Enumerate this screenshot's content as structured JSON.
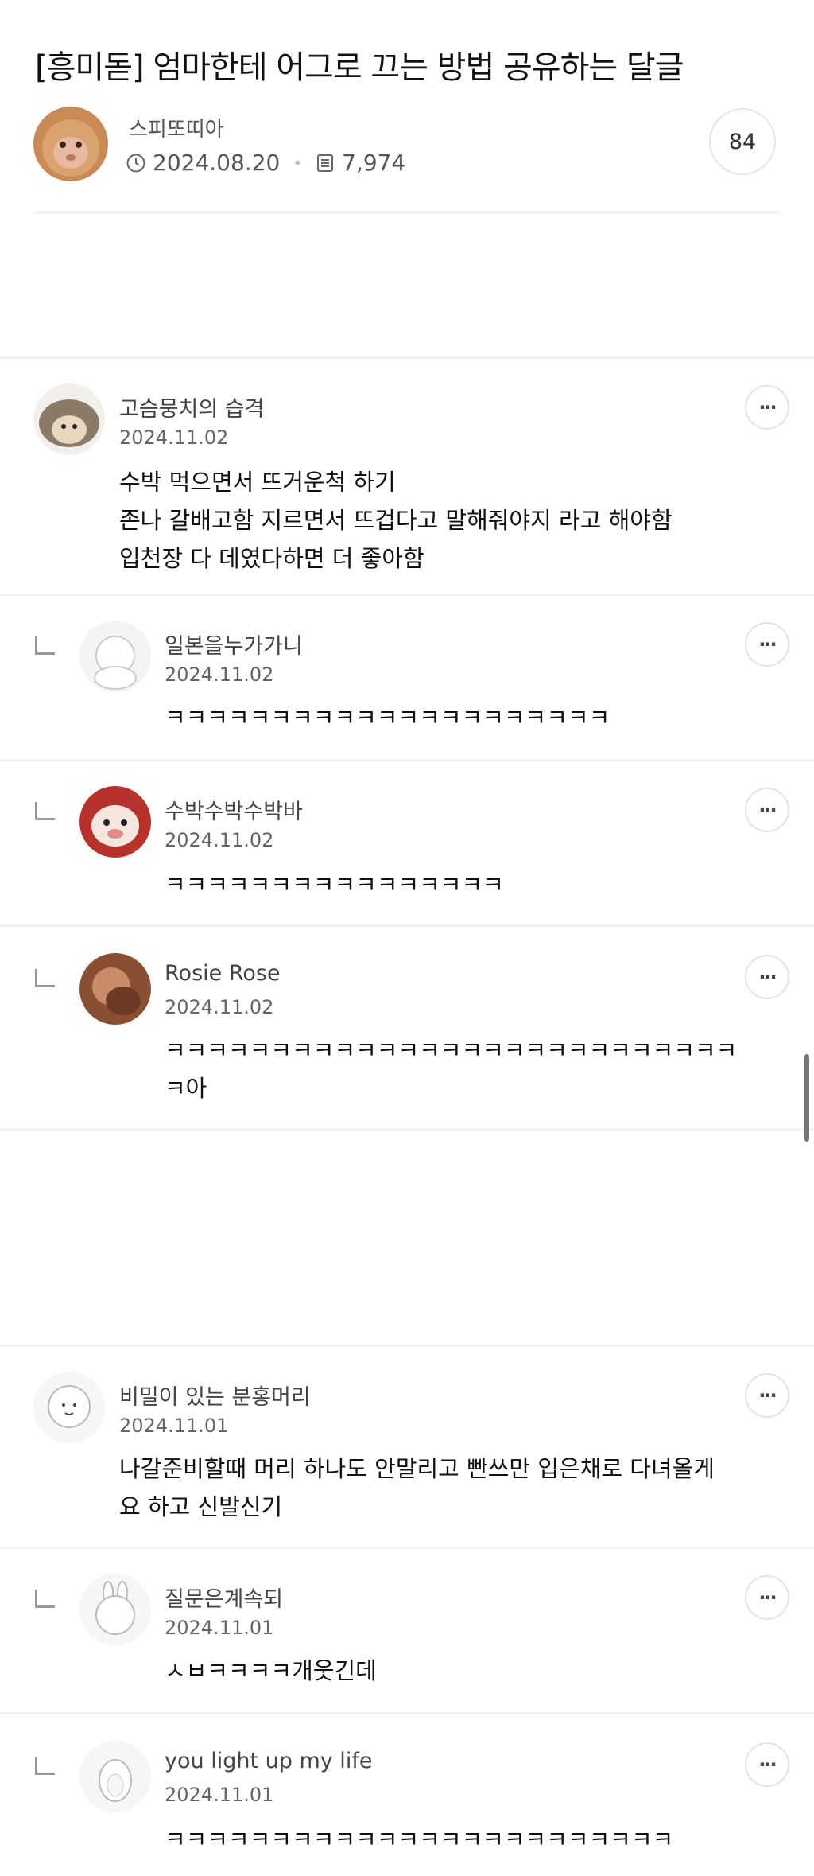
{
  "post": {
    "title": "[흥미돋] 엄마한테 어그로 끄는 방법 공유하는 달글",
    "author": "스피또띠아",
    "date": "2024.08.20",
    "views": "7,974",
    "comment_count": "84",
    "more_label": "···"
  },
  "comments": [
    {
      "author": "고슴뭉치의 습격",
      "date": "2024.11.02",
      "lines": [
        "수박 먹으면서 뜨거운척 하기",
        "존나 갈배고함 지르면서 뜨겁다고 말해줘야지 라고 해야함",
        "입천장 다 데였다하면 더 좋아함"
      ]
    },
    {
      "author": "일본을누가가니",
      "date": "2024.11.02",
      "lines": [
        "ㅋㅋㅋㅋㅋㅋㅋㅋㅋㅋㅋㅋㅋㅋㅋㅋㅋㅋㅋㅋㅋ"
      ]
    },
    {
      "author": "수박수박수박바",
      "date": "2024.11.02",
      "lines": [
        "ㅋㅋㅋㅋㅋㅋㅋㅋㅋㅋㅋㅋㅋㅋㅋㅋ"
      ]
    },
    {
      "author": "Rosie Rose",
      "date": "2024.11.02",
      "lines": [
        "ㅋㅋㅋㅋㅋㅋㅋㅋㅋㅋㅋㅋㅋㅋㅋㅋㅋㅋㅋㅋㅋㅋㅋㅋㅋㅋㅋ",
        "ㅋ아"
      ]
    },
    {
      "author": "비밀이 있는 분홍머리",
      "date": "2024.11.01",
      "lines": [
        "나갈준비할때 머리 하나도 안말리고 빤쓰만 입은채로 다녀올게",
        "요 하고 신발신기"
      ]
    },
    {
      "author": "질문은계속되",
      "date": "2024.11.01",
      "lines": [
        "ㅅㅂㅋㅋㅋㅋ개웃긴데"
      ]
    },
    {
      "author": "you light up my life",
      "date": "2024.11.01",
      "lines": [
        "ㅋㅋㅋㅋㅋㅋㅋㅋㅋㅋㅋㅋㅋㅋㅋㅋㅋㅋㅋㅋㅋㅋㅋㅋ"
      ]
    }
  ],
  "icons": {
    "clock": "clock-icon",
    "views": "document-icon",
    "more": "more-options-icon",
    "reply": "reply-arrow-icon"
  }
}
